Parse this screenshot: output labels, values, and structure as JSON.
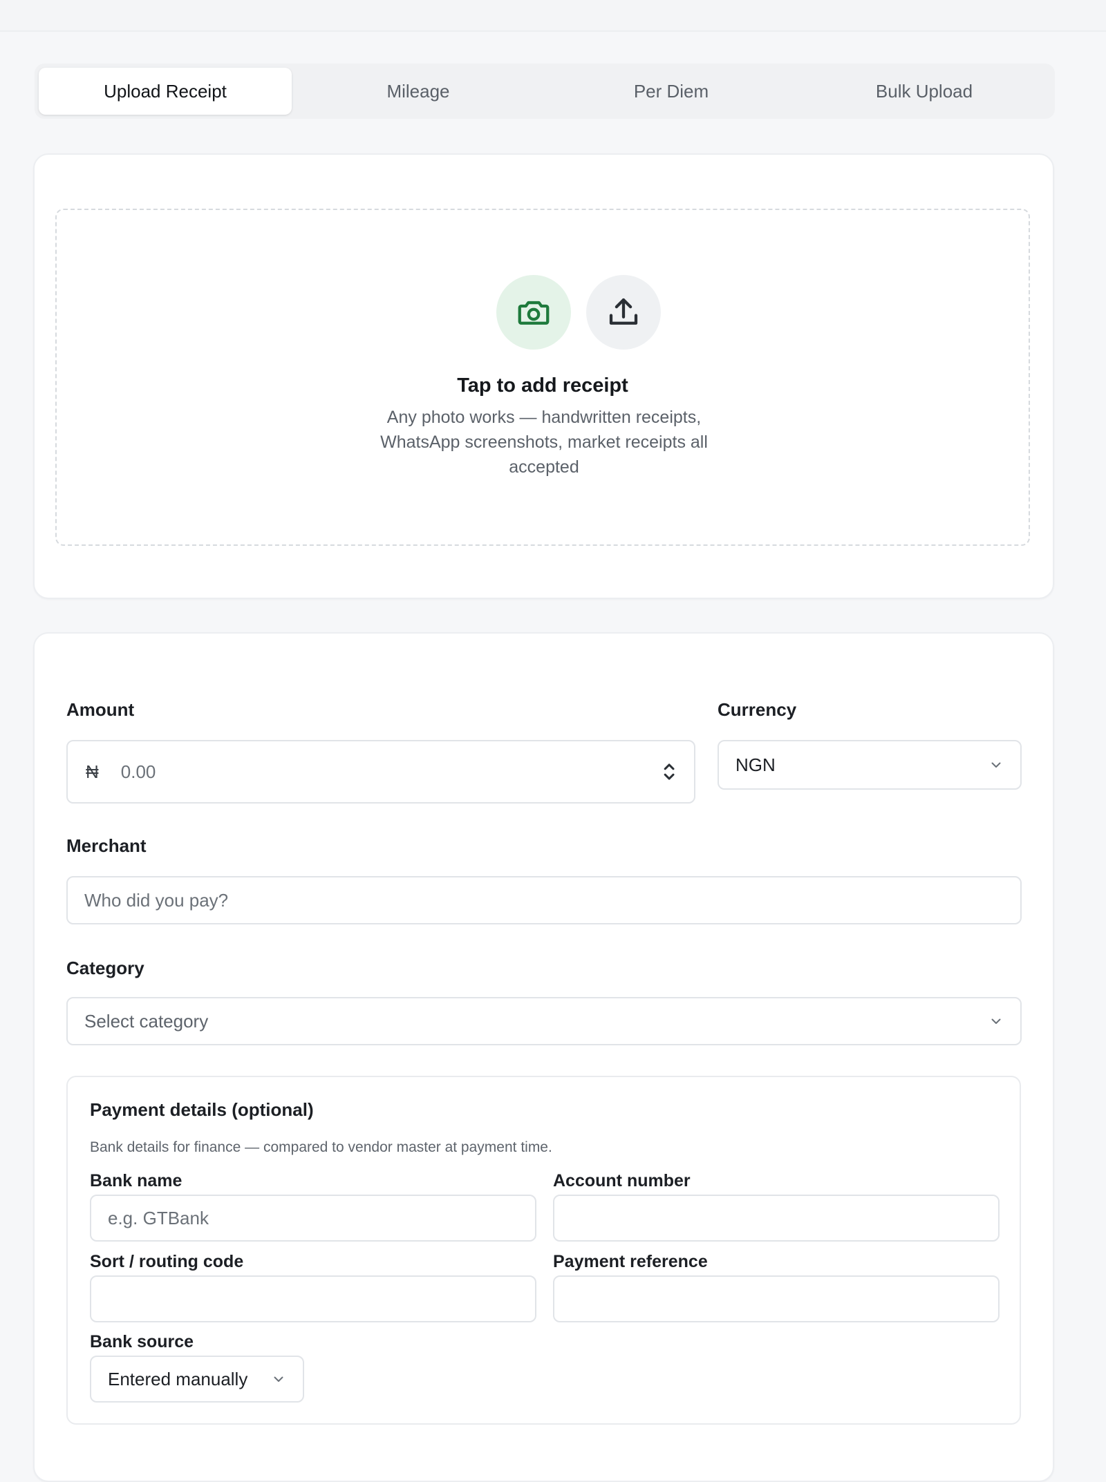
{
  "tabs": [
    {
      "label": "Upload Receipt",
      "active": true
    },
    {
      "label": "Mileage",
      "active": false
    },
    {
      "label": "Per Diem",
      "active": false
    },
    {
      "label": "Bulk Upload",
      "active": false
    }
  ],
  "upload": {
    "title": "Tap to add receipt",
    "subtitle": "Any photo works — handwritten receipts, WhatsApp screenshots, market receipts all accepted",
    "camera_icon": "camera-icon",
    "upload_icon": "upload-icon",
    "accent_color": "#1e7a3c"
  },
  "form": {
    "amount_label": "Amount",
    "currency_symbol": "₦",
    "amount_placeholder": "0.00",
    "currency_label": "Currency",
    "currency_value": "NGN",
    "merchant_label": "Merchant",
    "merchant_placeholder": "Who did you pay?",
    "category_label": "Category",
    "category_placeholder": "Select category"
  },
  "payment": {
    "title": "Payment details (optional)",
    "description": "Bank details for finance — compared to vendor master at payment time.",
    "bank_name_label": "Bank name",
    "bank_name_placeholder": "e.g. GTBank",
    "account_number_label": "Account number",
    "sort_code_label": "Sort / routing code",
    "payment_reference_label": "Payment reference",
    "bank_source_label": "Bank source",
    "bank_source_value": "Entered manually"
  }
}
